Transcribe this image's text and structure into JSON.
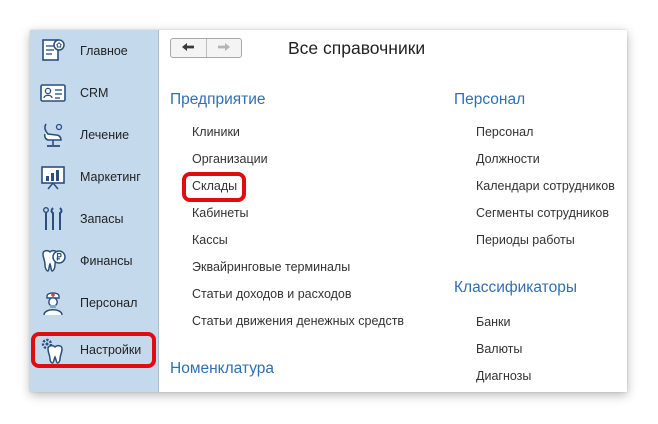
{
  "title": "Все справочники",
  "sidebar": {
    "items": [
      {
        "label": "Главное",
        "icon": "home-document-icon"
      },
      {
        "label": "CRM",
        "icon": "id-card-icon"
      },
      {
        "label": "Лечение",
        "icon": "dental-chair-icon"
      },
      {
        "label": "Маркетинг",
        "icon": "chart-board-icon"
      },
      {
        "label": "Запасы",
        "icon": "dental-tools-icon"
      },
      {
        "label": "Финансы",
        "icon": "tooth-coin-icon"
      },
      {
        "label": "Персонал",
        "icon": "doctor-icon"
      },
      {
        "label": "Настройки",
        "icon": "tooth-gear-icon"
      }
    ]
  },
  "sections": {
    "enterprise": {
      "title": "Предприятие",
      "items": [
        "Клиники",
        "Организации",
        "Склады",
        "Кабинеты",
        "Кассы",
        "Эквайринговые терминалы",
        "Статьи доходов и расходов",
        "Статьи движения денежных средств"
      ]
    },
    "nomenclature": {
      "title": "Номенклатура"
    },
    "personnel": {
      "title": "Персонал",
      "items": [
        "Персонал",
        "Должности",
        "Календари сотрудников",
        "Сегменты сотрудников",
        "Периоды работы"
      ]
    },
    "classifiers": {
      "title": "Классификаторы",
      "items": [
        "Банки",
        "Валюты",
        "Диагнозы"
      ]
    }
  },
  "colors": {
    "sidebar_bg": "#c5d9ed",
    "section_heading": "#2f6fb5",
    "highlight": "#e10b12"
  }
}
